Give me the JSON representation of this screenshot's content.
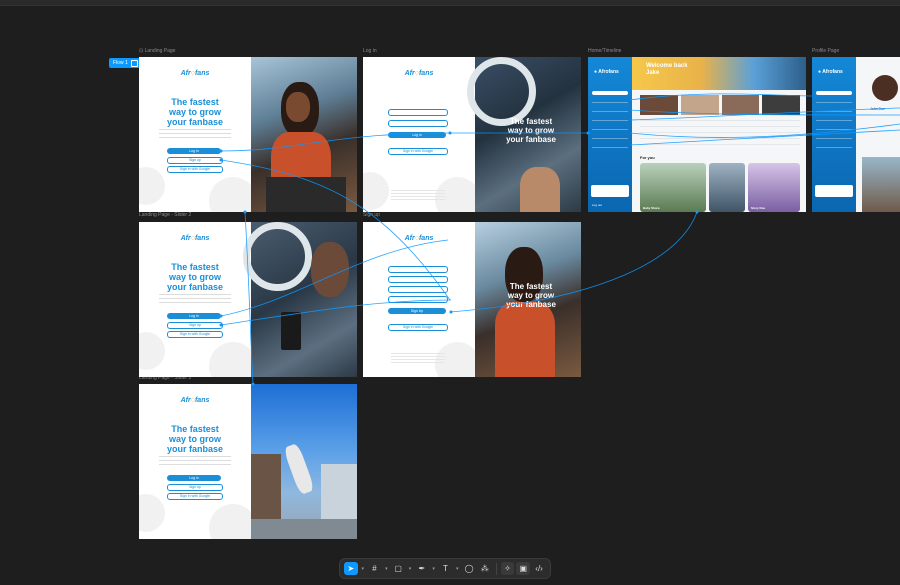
{
  "canvas": {
    "background": "#1e1e1e",
    "accent": "#0d99ff",
    "brand": "#1a8fd8"
  },
  "flow": {
    "label": "Flow 1"
  },
  "frames": {
    "landing": {
      "label": "Landing Page",
      "headline": [
        "The fastest",
        "way to grow",
        "your fanbase"
      ],
      "login": "Log in",
      "signup": "Sign up",
      "google": "Sign in with Google"
    },
    "login": {
      "label": "Log in",
      "overlay": [
        "The fastest",
        "way to grow",
        "your fanbase"
      ],
      "login": "Log in",
      "google": "Sign in with Google"
    },
    "home": {
      "label": "Home/Timeline",
      "welcome": [
        "Welcome back",
        "Jake"
      ],
      "for_you": "For you",
      "cards": [
        "Baby Shara",
        "Story Doe"
      ]
    },
    "profile": {
      "label": "Profile Page",
      "name": "John Doe"
    },
    "slider2": {
      "label": "Landing Page - Slider 2",
      "headline": [
        "The fastest",
        "way to grow",
        "your fanbase"
      ],
      "login": "Log in",
      "signup": "Sign up",
      "google": "Sign in with Google"
    },
    "signup": {
      "label": "Sign up",
      "overlay": [
        "The fastest",
        "way to grow",
        "your fanbase"
      ],
      "signup": "Sign Up",
      "google": "Sign in with Google"
    },
    "slider3": {
      "label": "Landing Page - Slider 3",
      "headline": [
        "The fastest",
        "way to grow",
        "your fanbase"
      ],
      "login": "Log in",
      "signup": "Sign up",
      "google": "Sign in with Google"
    }
  },
  "logo": {
    "text_a": "Afr",
    "text_b": "fans"
  },
  "toolbar": {
    "items": [
      "move-tool",
      "frame-tool",
      "shape-tool",
      "pen-tool",
      "text-tool",
      "comment-tool",
      "actions-tool",
      "dev-mode-toggle",
      "dev-mode-active",
      "code-view"
    ]
  }
}
